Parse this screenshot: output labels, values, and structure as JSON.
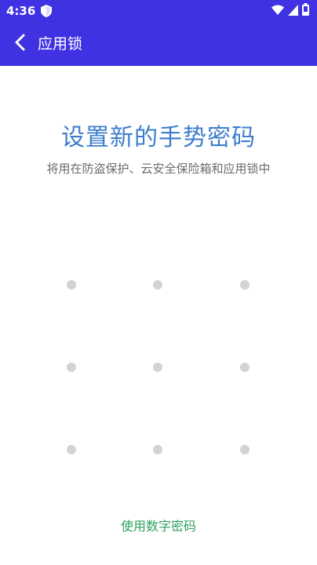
{
  "status_bar": {
    "time": "4:36",
    "icons": [
      "shield-icon",
      "wifi-icon",
      "signal-icon",
      "battery-icon"
    ]
  },
  "app_bar": {
    "title": "应用锁",
    "back_icon": "chevron-left-icon",
    "background_color": "#3f32e2"
  },
  "main": {
    "title": "设置新的手势密码",
    "subtitle": "将用在防盗保护、云安全保险箱和应用锁中",
    "pattern_dots": [
      1,
      2,
      3,
      4,
      5,
      6,
      7,
      8,
      9
    ],
    "switch_link": "使用数字密码"
  },
  "colors": {
    "title": "#3d7dcd",
    "subtitle": "#6b6b6b",
    "dot": "#d3d3d3",
    "link": "#2ea05d"
  }
}
